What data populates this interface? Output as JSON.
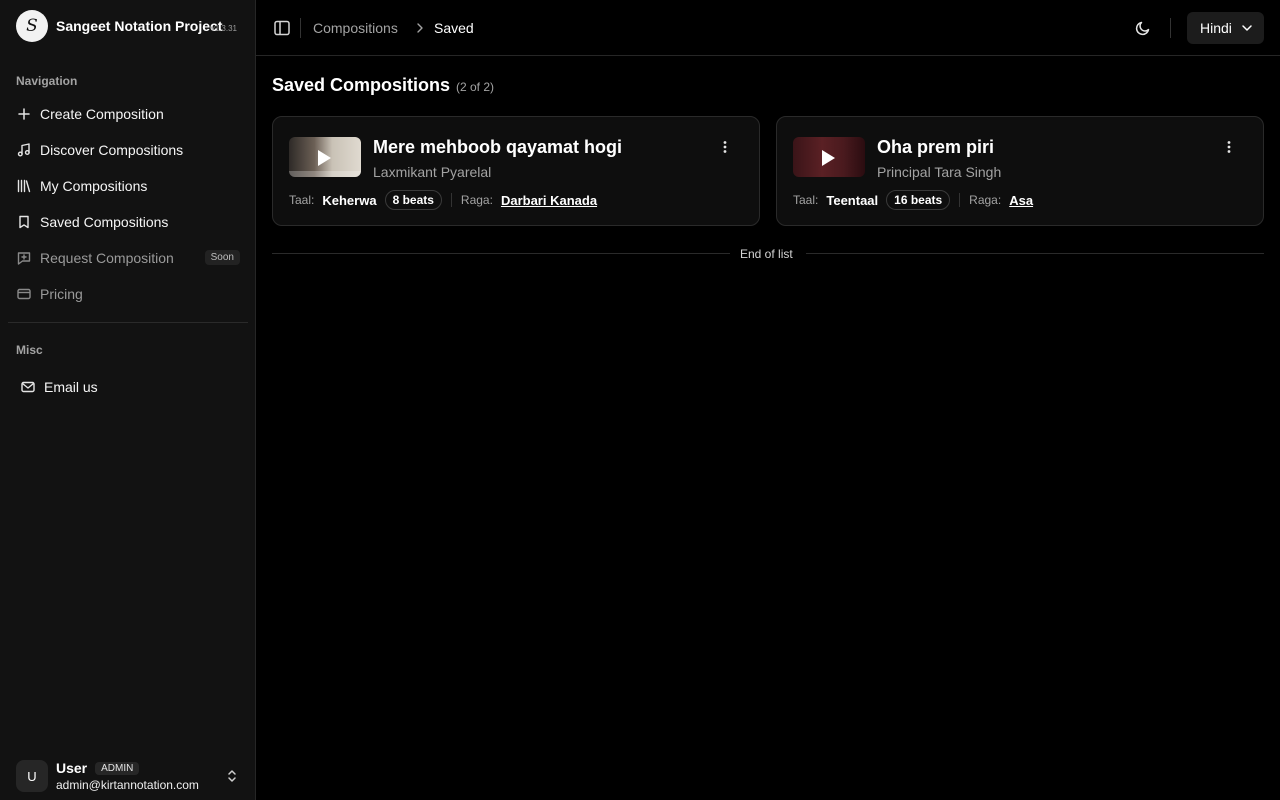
{
  "app": {
    "name": "Sangeet Notation Project",
    "version": "v1.3.31",
    "logo_glyph": "S"
  },
  "sidebar": {
    "nav_label": "Navigation",
    "items": [
      {
        "label": "Create Composition",
        "icon": "plus-icon"
      },
      {
        "label": "Discover Compositions",
        "icon": "music-note-icon"
      },
      {
        "label": "My Compositions",
        "icon": "library-icon"
      },
      {
        "label": "Saved Compositions",
        "icon": "bookmark-icon"
      },
      {
        "label": "Request Composition",
        "icon": "message-plus-icon",
        "badge": "Soon",
        "disabled": true
      },
      {
        "label": "Pricing",
        "icon": "credit-card-icon",
        "disabled": true
      }
    ],
    "misc_label": "Misc",
    "misc_items": [
      {
        "label": "Email us",
        "icon": "mail-icon"
      }
    ]
  },
  "user": {
    "initial": "U",
    "name": "User",
    "role": "ADMIN",
    "email": "admin@kirtannotation.com"
  },
  "header": {
    "breadcrumb": [
      {
        "label": "Compositions"
      },
      {
        "label": "Saved"
      }
    ],
    "language": "Hindi"
  },
  "main": {
    "title": "Saved Compositions",
    "count": "(2 of 2)",
    "compositions": [
      {
        "title": "Mere mehboob qayamat hogi",
        "artist": "Laxmikant Pyarelal",
        "taal_label": "Taal:",
        "taal": "Keherwa",
        "beats": "8 beats",
        "raga_label": "Raga:",
        "raga": "Darbari Kanada"
      },
      {
        "title": "Oha prem piri",
        "artist": "Principal Tara Singh",
        "taal_label": "Taal:",
        "taal": "Teentaal",
        "beats": "16 beats",
        "raga_label": "Raga:",
        "raga": "Asa"
      }
    ],
    "end_text": "End of list"
  },
  "colors": {
    "background": "#000000",
    "sidebar": "#121212",
    "border": "#262626",
    "text": "#fafafa",
    "muted": "#a3a3a3"
  }
}
